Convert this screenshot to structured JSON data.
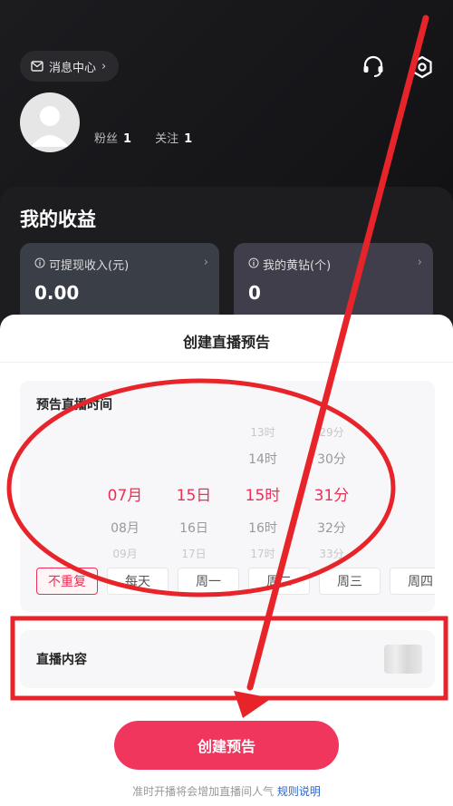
{
  "header": {
    "message_center": "消息中心",
    "fans_label": "粉丝",
    "fans_count": "1",
    "following_label": "关注",
    "following_count": "1"
  },
  "earnings": {
    "title": "我的收益",
    "cards": [
      {
        "label": "可提现收入(元)",
        "value": "0.00"
      },
      {
        "label": "我的黄钻(个)",
        "value": "0"
      }
    ]
  },
  "sheet": {
    "title": "创建直播预告",
    "time_label": "预告直播时间",
    "picker": {
      "month": [
        "07月",
        "08月",
        "09月"
      ],
      "day": [
        "15日",
        "16日",
        "17日"
      ],
      "hour": [
        "13时",
        "14时",
        "15时",
        "16时",
        "17时"
      ],
      "minute": [
        "29分",
        "30分",
        "31分",
        "32分",
        "33分"
      ]
    },
    "repeat_options": [
      "不重复",
      "每天",
      "周一",
      "周二",
      "周三",
      "周四"
    ],
    "selected_repeat": "不重复",
    "content_label": "直播内容",
    "create_button": "创建预告",
    "hint_text": "准时开播将会增加直播间人气",
    "hint_link": "规则说明"
  },
  "colors": {
    "accent": "#ef2e55",
    "annotation": "#e8242b",
    "link": "#2a64c5"
  }
}
